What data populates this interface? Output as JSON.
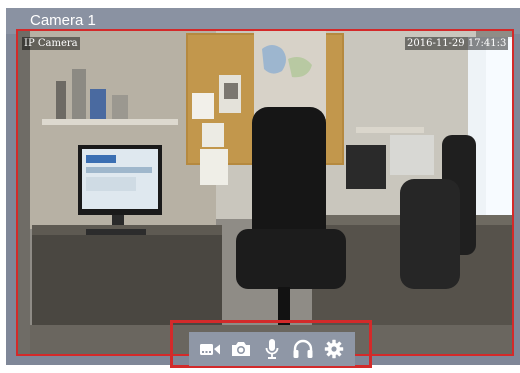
{
  "window": {
    "title": "Camera 1"
  },
  "video": {
    "osd_label": "IP Camera",
    "timestamp": "2016-11-29 17:41:3"
  },
  "controls": [
    {
      "name": "record-video-icon"
    },
    {
      "name": "snapshot-camera-icon"
    },
    {
      "name": "microphone-icon"
    },
    {
      "name": "headphones-icon"
    },
    {
      "name": "settings-gear-icon"
    }
  ],
  "colors": {
    "title_bar": "#8a92a2",
    "highlight": "#d32a2a",
    "control_bar": "#8f97a6",
    "icon": "#ffffff"
  }
}
